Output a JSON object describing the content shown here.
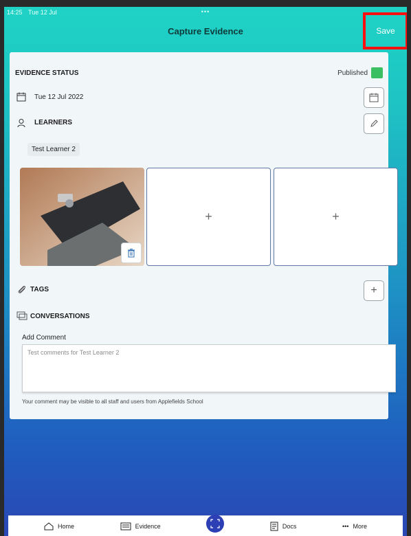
{
  "status_bar": {
    "time": "14:25",
    "date": "Tue 12 Jul",
    "dots": "•••"
  },
  "header": {
    "title": "Capture Evidence",
    "save_label": "Save"
  },
  "evidence": {
    "status_label": "EVIDENCE STATUS",
    "published_label": "Published",
    "date_value": "Tue 12 Jul 2022",
    "learners_label": "LEARNERS",
    "learners": [
      "Test Learner 2"
    ],
    "plus": "+"
  },
  "tags": {
    "label": "TAGS",
    "add_glyph": "+"
  },
  "conversations": {
    "label": "CONVERSATIONS",
    "add_comment_label": "Add Comment",
    "comment_value": "Test comments for Test Learner 2",
    "visibility_note": "Your comment may be visible to all staff and users from Applefields School"
  },
  "tabbar": {
    "items": [
      {
        "label": "Home",
        "icon": "home-icon"
      },
      {
        "label": "Evidence",
        "icon": "evidence-icon"
      },
      {
        "label": "",
        "icon": "scan-icon"
      },
      {
        "label": "Docs",
        "icon": "docs-icon"
      },
      {
        "label": "More",
        "icon": "more-icon",
        "prefix": "•••"
      }
    ]
  },
  "colors": {
    "accent_top": "#1fd3c5",
    "accent_bottom": "#2a47b3",
    "published_green": "#3bbf63",
    "save_highlight": "#ff1010"
  }
}
